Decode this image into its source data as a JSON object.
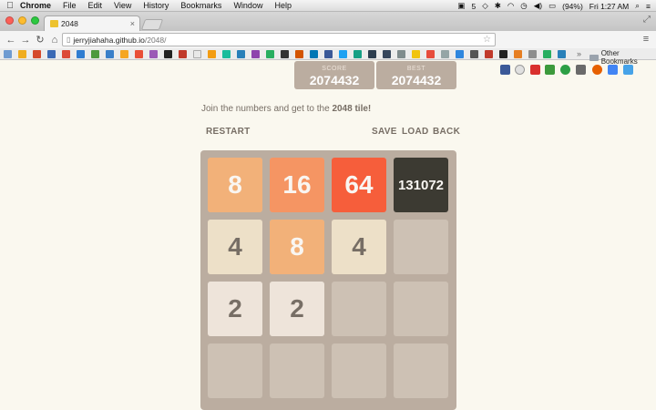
{
  "menubar": {
    "app": "Chrome",
    "items": [
      "File",
      "Edit",
      "View",
      "History",
      "Bookmarks",
      "Window",
      "Help"
    ],
    "status_badge": "5",
    "battery": "(94%)",
    "clock": "Fri 1:27 AM"
  },
  "tab": {
    "title": "2048",
    "close": "×"
  },
  "address": {
    "host": "jerryjiahaha.github.io",
    "path": "/2048/"
  },
  "bookmarks": {
    "more": "»",
    "other": "Other Bookmarks"
  },
  "score": {
    "label": "SCORE",
    "value": "2074432"
  },
  "best": {
    "label": "BEST",
    "value": "2074432"
  },
  "intro": {
    "prefix": "Join the numbers and get to the ",
    "goal": "2048 tile!"
  },
  "controls": {
    "restart": "RESTART",
    "save": "SAVE",
    "load": "LOAD",
    "back": "BACK"
  },
  "grid": [
    [
      "8",
      "16",
      "64",
      "131072"
    ],
    [
      "4",
      "8",
      "4",
      ""
    ],
    [
      "2",
      "2",
      "",
      ""
    ],
    [
      "",
      "",
      "",
      ""
    ]
  ],
  "tile_colors": {
    "2": {
      "bg": "#eee4da",
      "fg": "#776e65"
    },
    "4": {
      "bg": "#ede0c8",
      "fg": "#776e65"
    },
    "8": {
      "bg": "#f2b179",
      "fg": "#f9f6f2"
    },
    "16": {
      "bg": "#f59563",
      "fg": "#f9f6f2"
    },
    "64": {
      "bg": "#f65e3b",
      "fg": "#f9f6f2"
    },
    "131072": {
      "bg": "#3c3a32",
      "fg": "#f9f6f2"
    }
  },
  "colors": {
    "board": "#bbada0",
    "cell": "#cdc1b4",
    "text": "#776e65",
    "page": "#faf8ef"
  }
}
